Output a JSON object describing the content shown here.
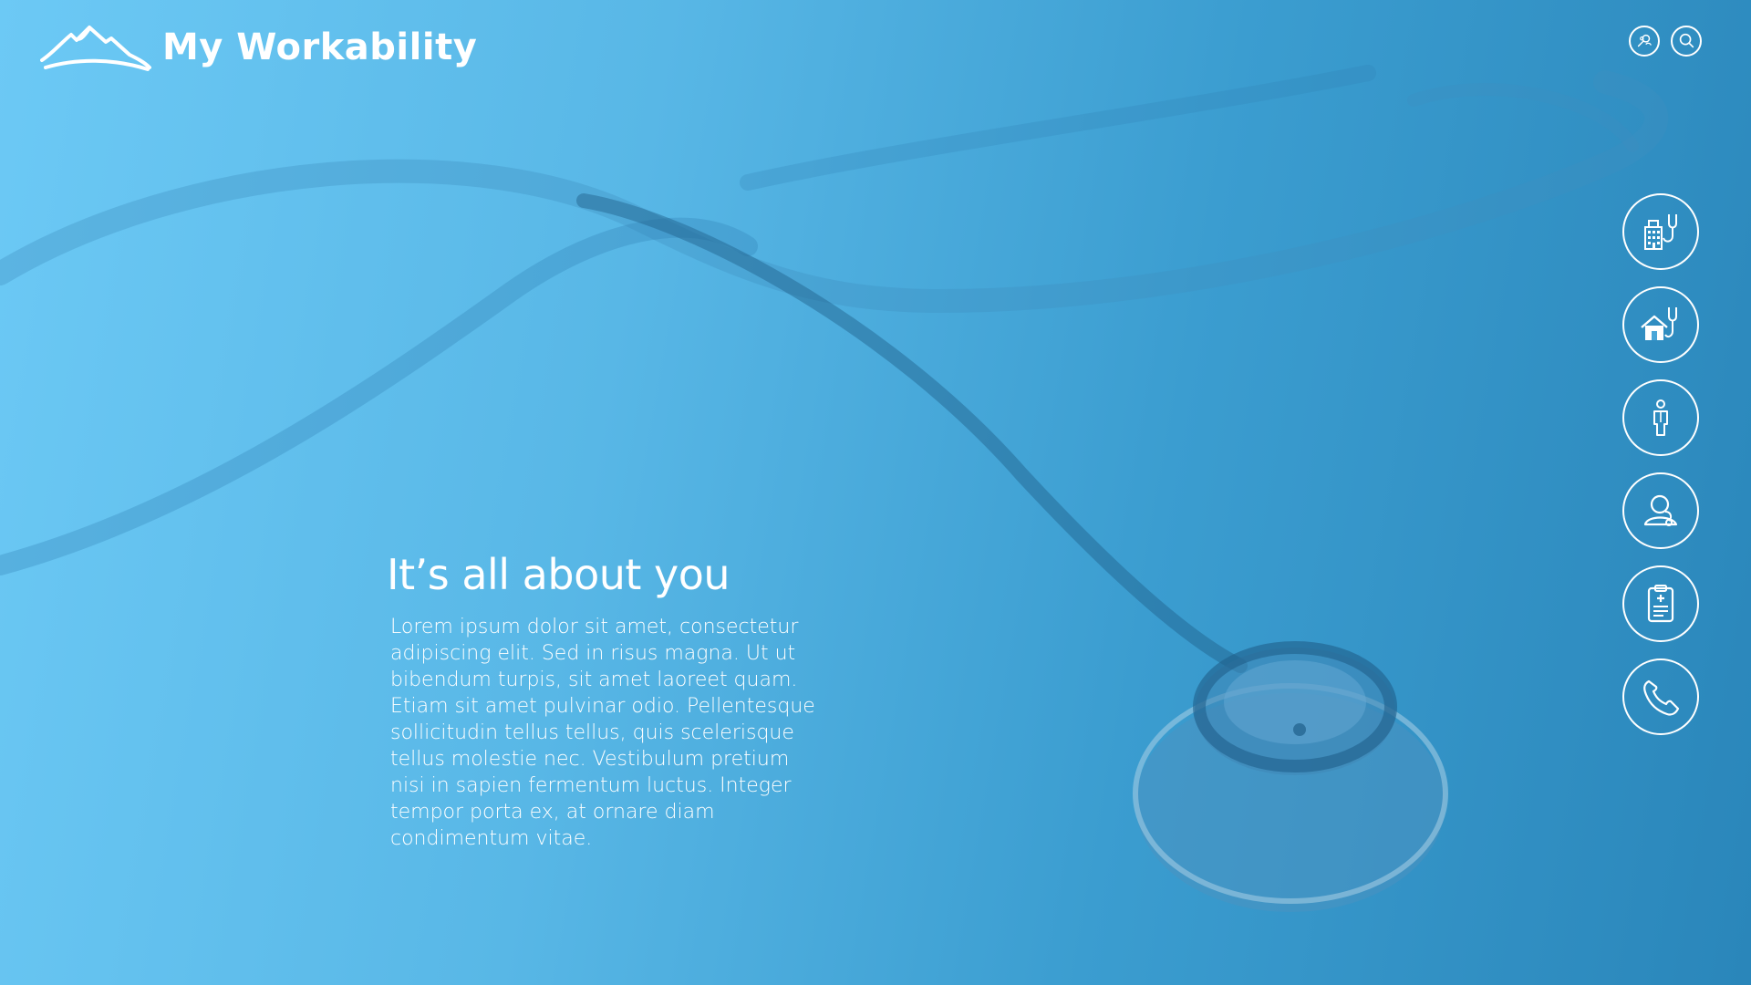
{
  "brand": {
    "name": "My Workability",
    "logo_icon": "mountain-logo-icon"
  },
  "header": {
    "actions": [
      {
        "icon": "find-person-icon"
      },
      {
        "icon": "search-icon"
      }
    ]
  },
  "side_nav": {
    "items": [
      {
        "icon": "hospital-stethoscope-icon"
      },
      {
        "icon": "home-care-stethoscope-icon"
      },
      {
        "icon": "person-icon"
      },
      {
        "icon": "patient-care-icon"
      },
      {
        "icon": "medical-clipboard-icon"
      },
      {
        "icon": "phone-icon"
      }
    ]
  },
  "hero": {
    "title": "It’s all about you",
    "body": "Lorem ipsum dolor sit amet, consectetur adipiscing elit. Sed in risus magna. Ut ut bibendum turpis, sit amet laoreet quam. Etiam sit amet pulvinar odio. Pellentesque sollicitudin tellus tellus, quis scelerisque tellus molestie nec. Vestibulum pretium nisi in sapien fermentum luctus. Integer tempor porta ex, at ornare diam condimentum vitae."
  },
  "colors": {
    "background_light": "#6cc9f5",
    "background_dark": "#2a86ba",
    "foreground": "#ffffff"
  }
}
